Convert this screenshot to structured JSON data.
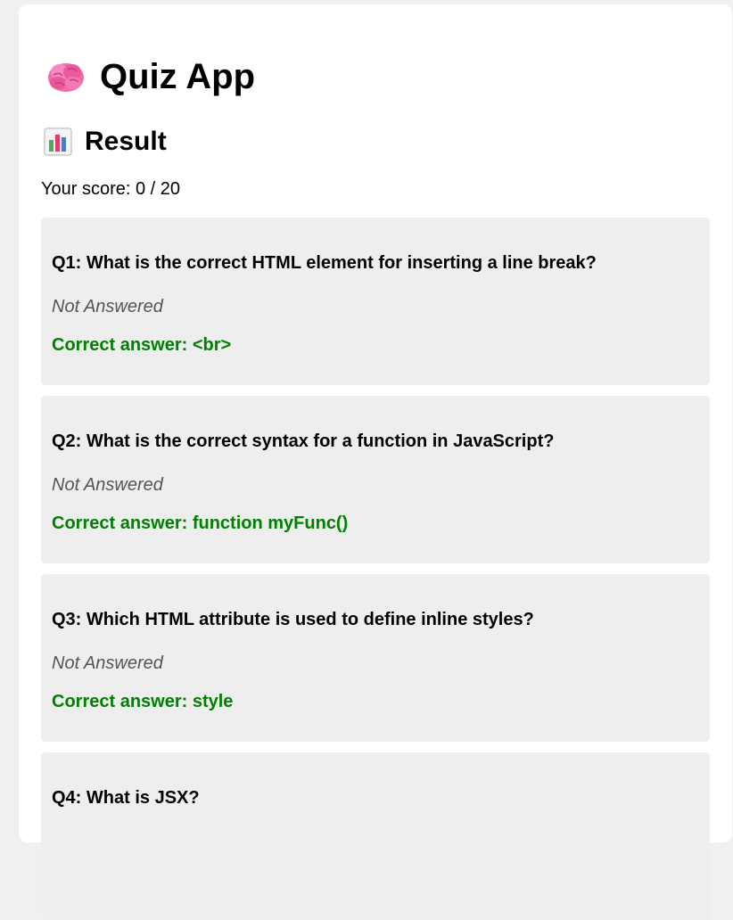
{
  "app": {
    "title": "Quiz App",
    "icon": "brain-icon"
  },
  "result": {
    "heading": "Result",
    "icon": "bar-chart-icon",
    "score_text": "Your score: 0 / 20"
  },
  "questions": [
    {
      "text": "Q1: What is the correct HTML element for inserting a line break?",
      "status": "Not Answered",
      "correct": "Correct answer: <br>"
    },
    {
      "text": "Q2: What is the correct syntax for a function in JavaScript?",
      "status": "Not Answered",
      "correct": "Correct answer: function myFunc()"
    },
    {
      "text": "Q3: Which HTML attribute is used to define inline styles?",
      "status": "Not Answered",
      "correct": "Correct answer: style"
    },
    {
      "text": "Q4: What is JSX?",
      "status": "",
      "correct": ""
    }
  ],
  "colors": {
    "page_background": "#f0f0f0",
    "card_background": "#ffffff",
    "question_background": "#eeeeee",
    "correct_answer": "#008000",
    "status_text": "#555555"
  }
}
